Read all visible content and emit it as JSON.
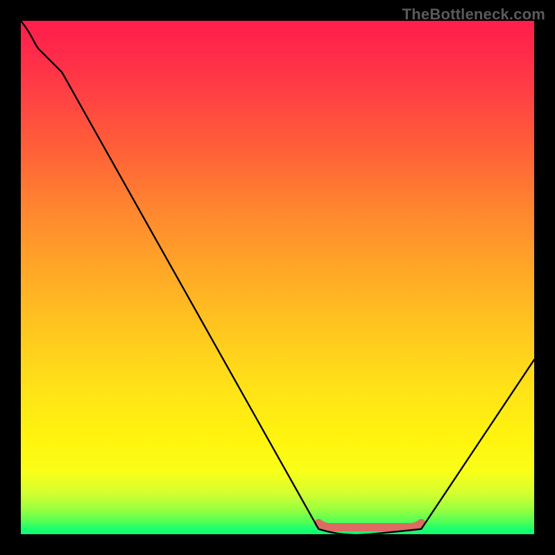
{
  "watermark": "TheBottleneck.com",
  "chart_data": {
    "type": "line",
    "title": "",
    "xlabel": "",
    "ylabel": "",
    "xlim": [
      0,
      100
    ],
    "ylim": [
      0,
      100
    ],
    "series": [
      {
        "name": "curve",
        "x": [
          0,
          4,
          8,
          58,
          68,
          78,
          100
        ],
        "y": [
          100,
          94,
          90,
          1,
          0,
          1,
          34
        ]
      }
    ],
    "marker_range_x": [
      58,
      78
    ],
    "note": "V-shaped curve with trough near x=68; red marker segment along bottom between x≈58–78; rainbow vertical gradient background on black frame"
  }
}
